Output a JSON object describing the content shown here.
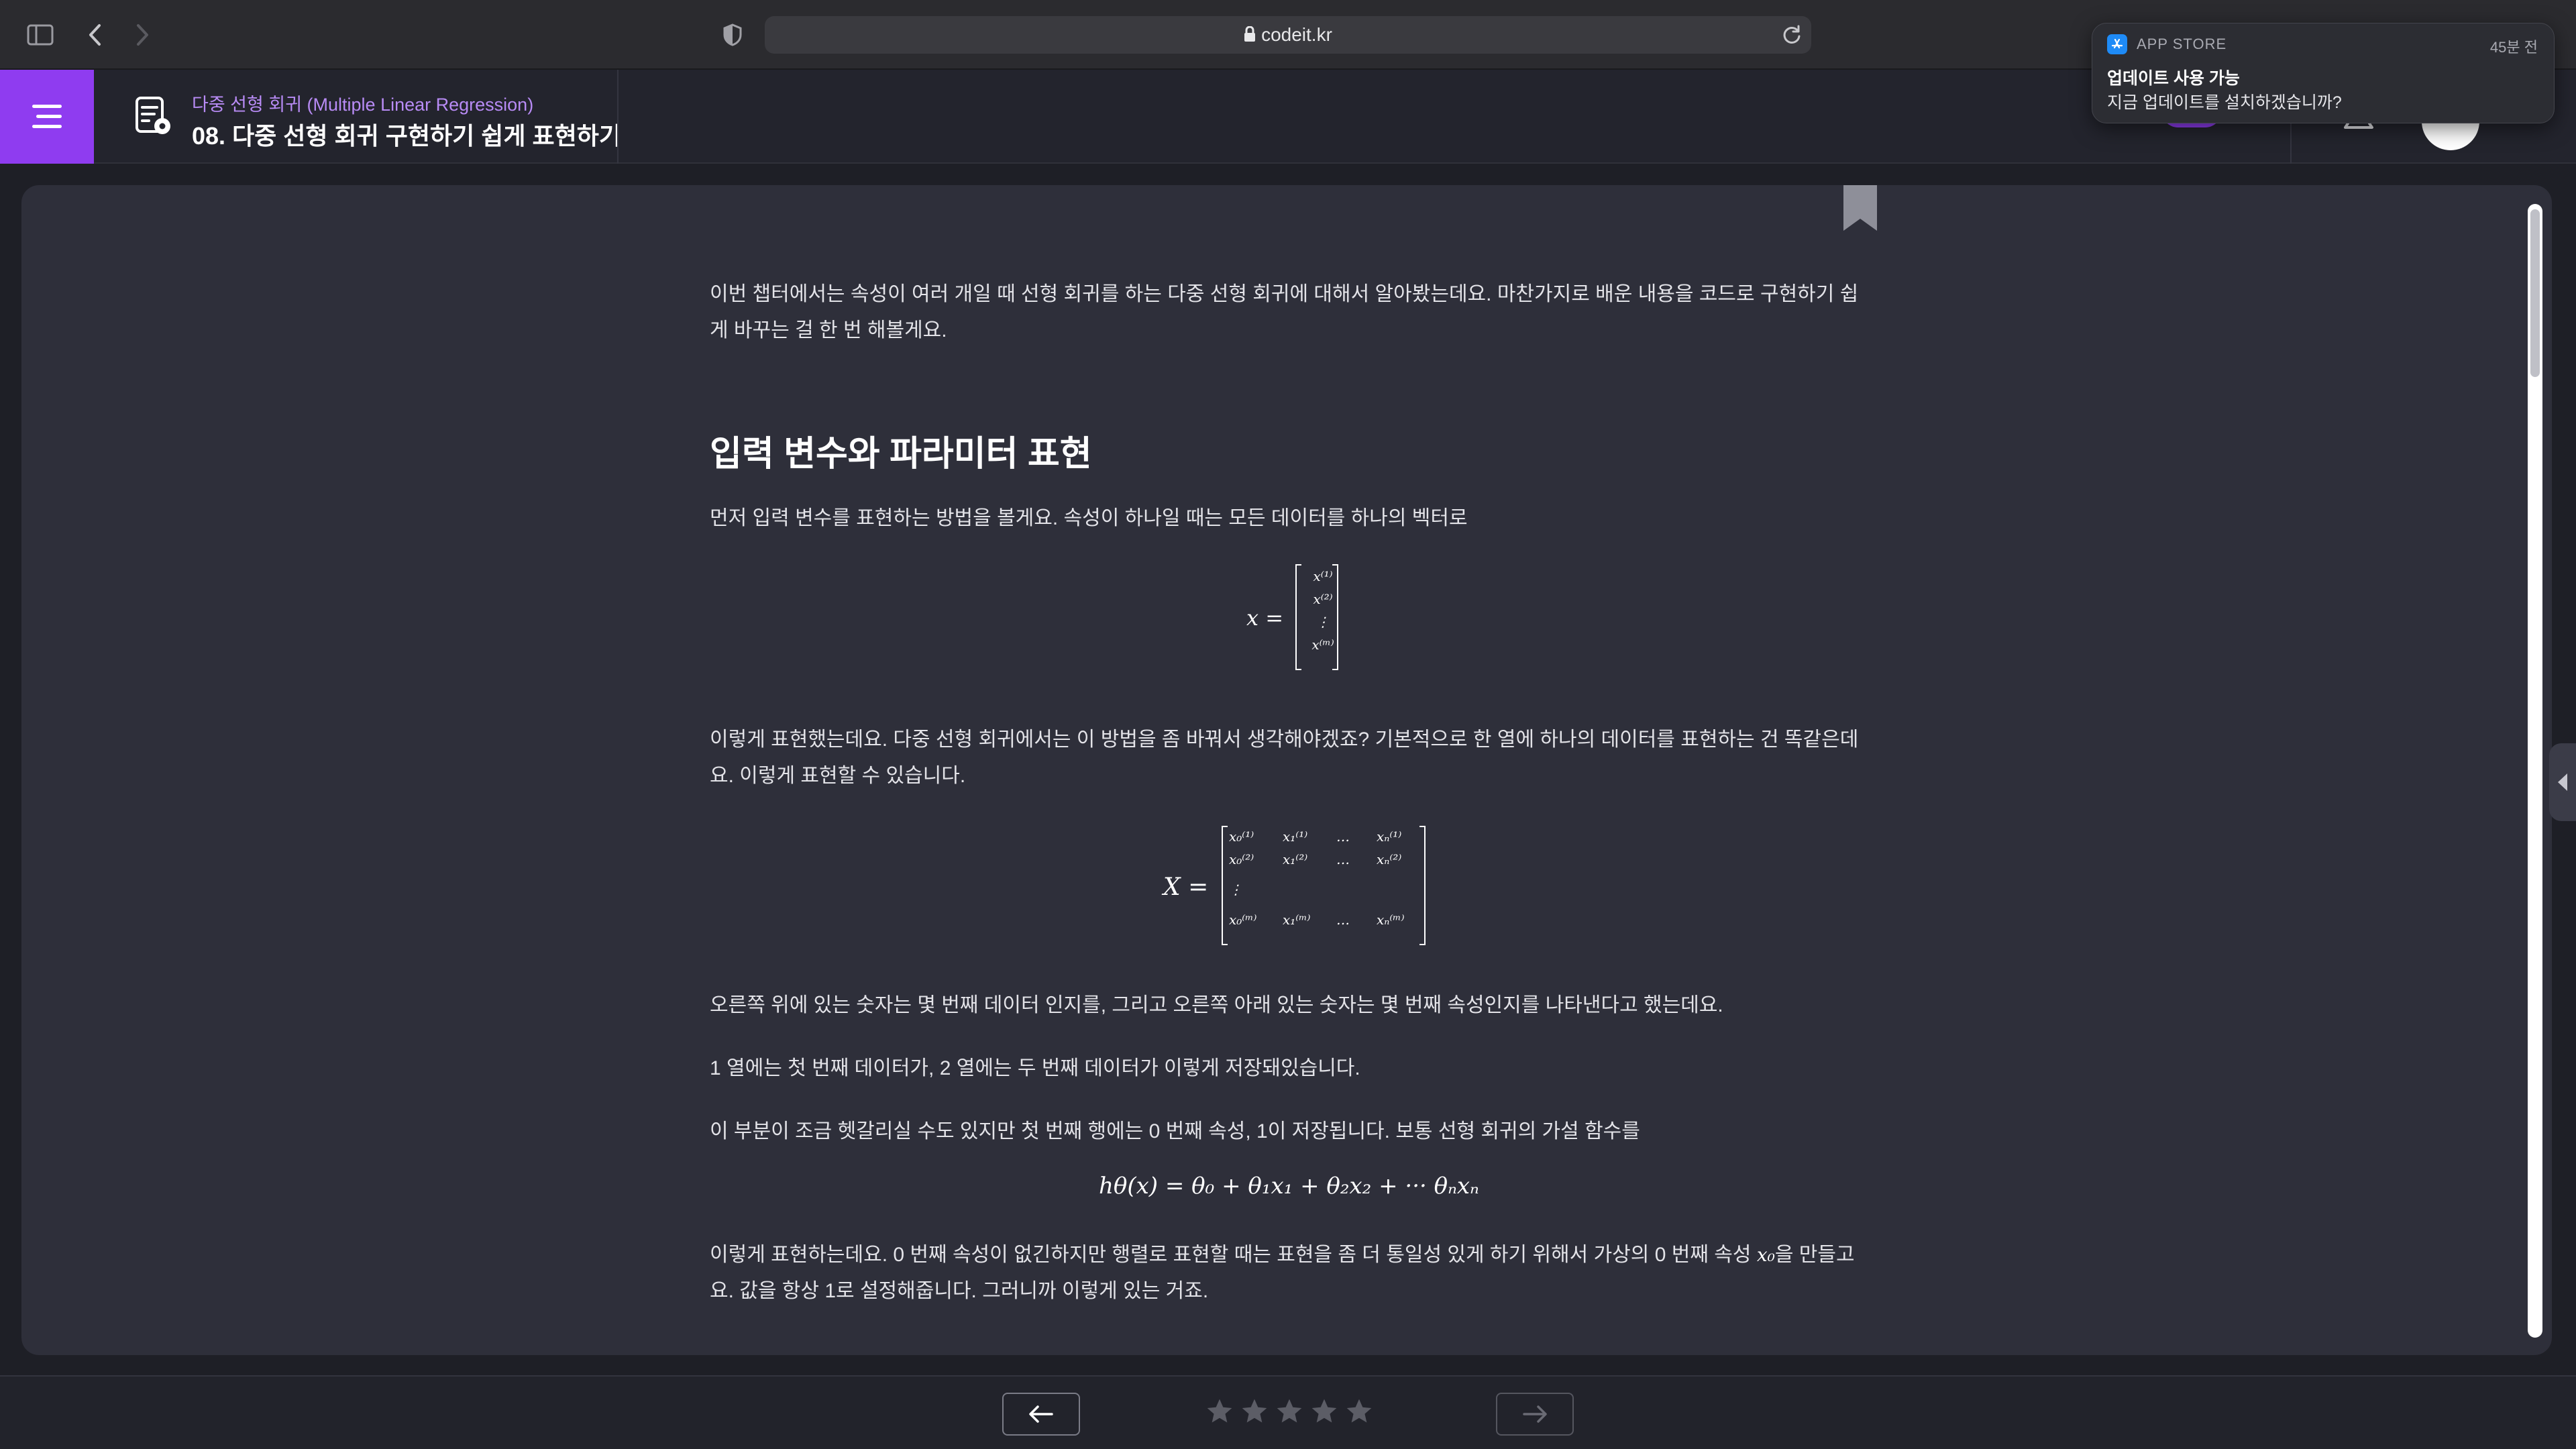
{
  "browser": {
    "url": "codeit.kr"
  },
  "header": {
    "course_name": "다중 선형 회귀 (Multiple Linear Regression)",
    "lesson_title": "08. 다중 선형 회귀 구현하기 쉽게 표현하기"
  },
  "article": {
    "intro_line1": "이번 챕터에서는 속성이 여러 개일 때 선형 회귀를 하는 다중 선형 회귀에 대해서 알아봤는데요. 마찬가지로 배운 내용을 코드로 구현하기 쉽",
    "intro_line2": "게 바꾸는 걸 한 번 해볼게요.",
    "heading": "입력 변수와 파라미터 표현",
    "p1": "먼저 입력 변수를 표현하는 방법을 볼게요. 속성이 하나일 때는 모든 데이터를 하나의 벡터로",
    "p2_line1": "이렇게 표현했는데요. 다중 선형 회귀에서는 이 방법을 좀 바꿔서 생각해야겠죠? 기본적으로 한 열에 하나의 데이터를 표현하는 건 똑같은데",
    "p2_line2": "요. 이렇게 표현할 수 있습니다.",
    "p3": "오른쪽 위에 있는 숫자는 몇 번째 데이터 인지를, 그리고 오른쪽 아래 있는 숫자는 몇 번째 속성인지를 나타낸다고 했는데요.",
    "p4": "1 열에는 첫 번째 데이터가, 2 열에는 두 번째 데이터가 이렇게 저장돼있습니다.",
    "p5": "이 부분이 조금 헷갈리실 수도 있지만 첫 번째 행에는 0 번째 속성, 1이 저장됩니다. 보통 선형 회귀의 가설 함수를",
    "p6_line1_a": "이렇게 표현하는데요. 0 번째 속성이 없긴하지만 행렬로 표현할 때는 표현을 좀 더 통일성 있게 하기 위해서 가상의 0 번째 속성",
    "p6_line1_b": "을 만들고",
    "p6_line2": "요. 값을 항상 1로 설정해줍니다. 그러니까 이렇게 있는 거죠."
  },
  "math": {
    "vec_lhs": "x =",
    "vec_entries": [
      "x⁽¹⁾",
      "x⁽²⁾",
      "⋮",
      "x⁽ᵐ⁾"
    ],
    "mat_lhs": "X =",
    "mat_rows": [
      [
        "x₀⁽¹⁾",
        "x₁⁽¹⁾",
        "…",
        "xₙ⁽¹⁾"
      ],
      [
        "x₀⁽²⁾",
        "x₁⁽²⁾",
        "…",
        "xₙ⁽²⁾"
      ],
      [
        "⋮",
        "",
        "",
        ""
      ],
      [
        "x₀⁽ᵐ⁾",
        "x₁⁽ᵐ⁾",
        "…",
        "xₙ⁽ᵐ⁾"
      ]
    ],
    "hypothesis": "hθ(x) = θ₀ + θ₁x₁ + θ₂x₂ + ··· θₙxₙ",
    "inline_x0": "x₀"
  },
  "rating": {
    "stars": 5,
    "filled": 0
  },
  "notification": {
    "app": "APP STORE",
    "time": "45분 전",
    "title": "업데이트 사용 가능",
    "body": "지금 업데이트를 설치하겠습니까?"
  },
  "colors": {
    "accent": "#8f3cf0",
    "background": "#1e1f26",
    "card": "#2e2f3a"
  }
}
